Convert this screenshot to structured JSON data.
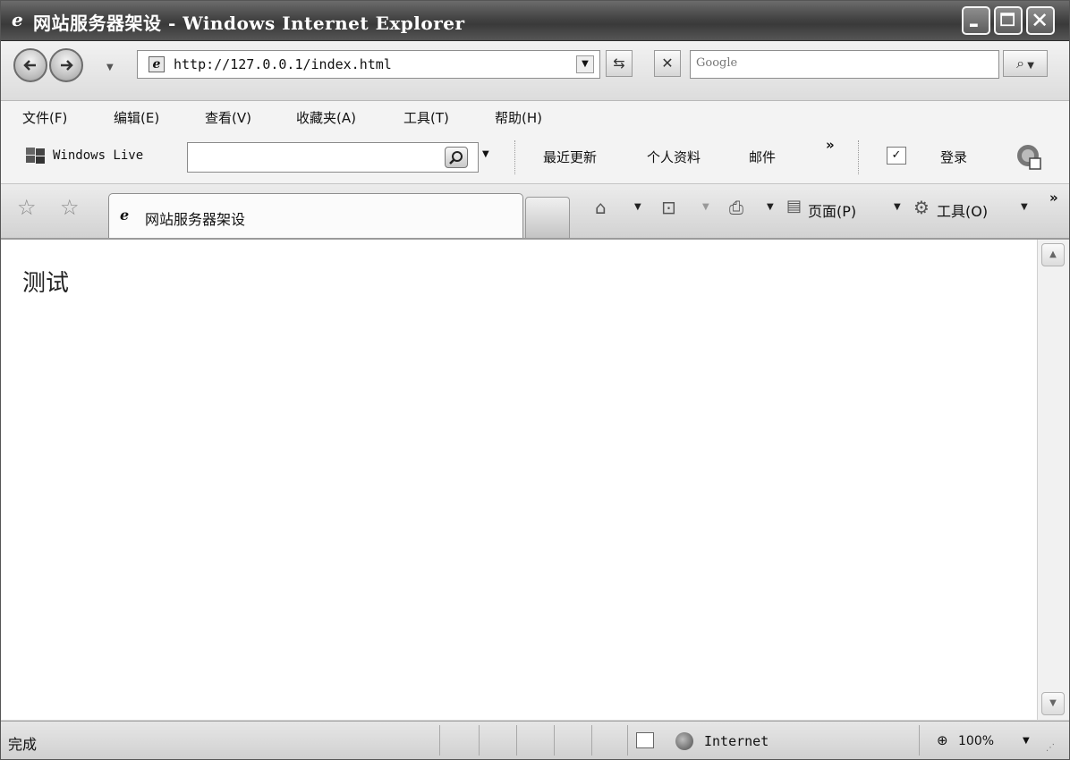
{
  "window": {
    "title": "网站服务器架设 - Windows Internet Explorer"
  },
  "address_bar": {
    "url": "http://127.0.0.1/index.html",
    "search_placeholder": "Google"
  },
  "menu": {
    "items": [
      "文件(F)",
      "编辑(E)",
      "查看(V)",
      "收藏夹(A)",
      "工具(T)",
      "帮助(H)"
    ]
  },
  "live_toolbar": {
    "brand": "Windows Live",
    "search_value": "",
    "links": [
      "最近更新",
      "个人资料",
      "邮件"
    ],
    "more": "»",
    "sign_in": "登录"
  },
  "tab_bar": {
    "active_tab_title": "网站服务器架设",
    "page_menu": "页面(P)",
    "tools_menu": "工具(O)",
    "more": "»"
  },
  "content": {
    "text": "测试"
  },
  "status_bar": {
    "status": "完成",
    "zone": "Internet",
    "zoom": "100%"
  },
  "icons": {
    "ie": "ie-logo-icon",
    "back": "back-arrow-icon",
    "forward": "forward-arrow-icon",
    "refresh": "refresh-icon",
    "stop": "stop-icon",
    "search": "search-icon",
    "home": "home-icon",
    "feeds": "rss-feed-icon",
    "print": "printer-icon",
    "tools": "gear-icon"
  }
}
